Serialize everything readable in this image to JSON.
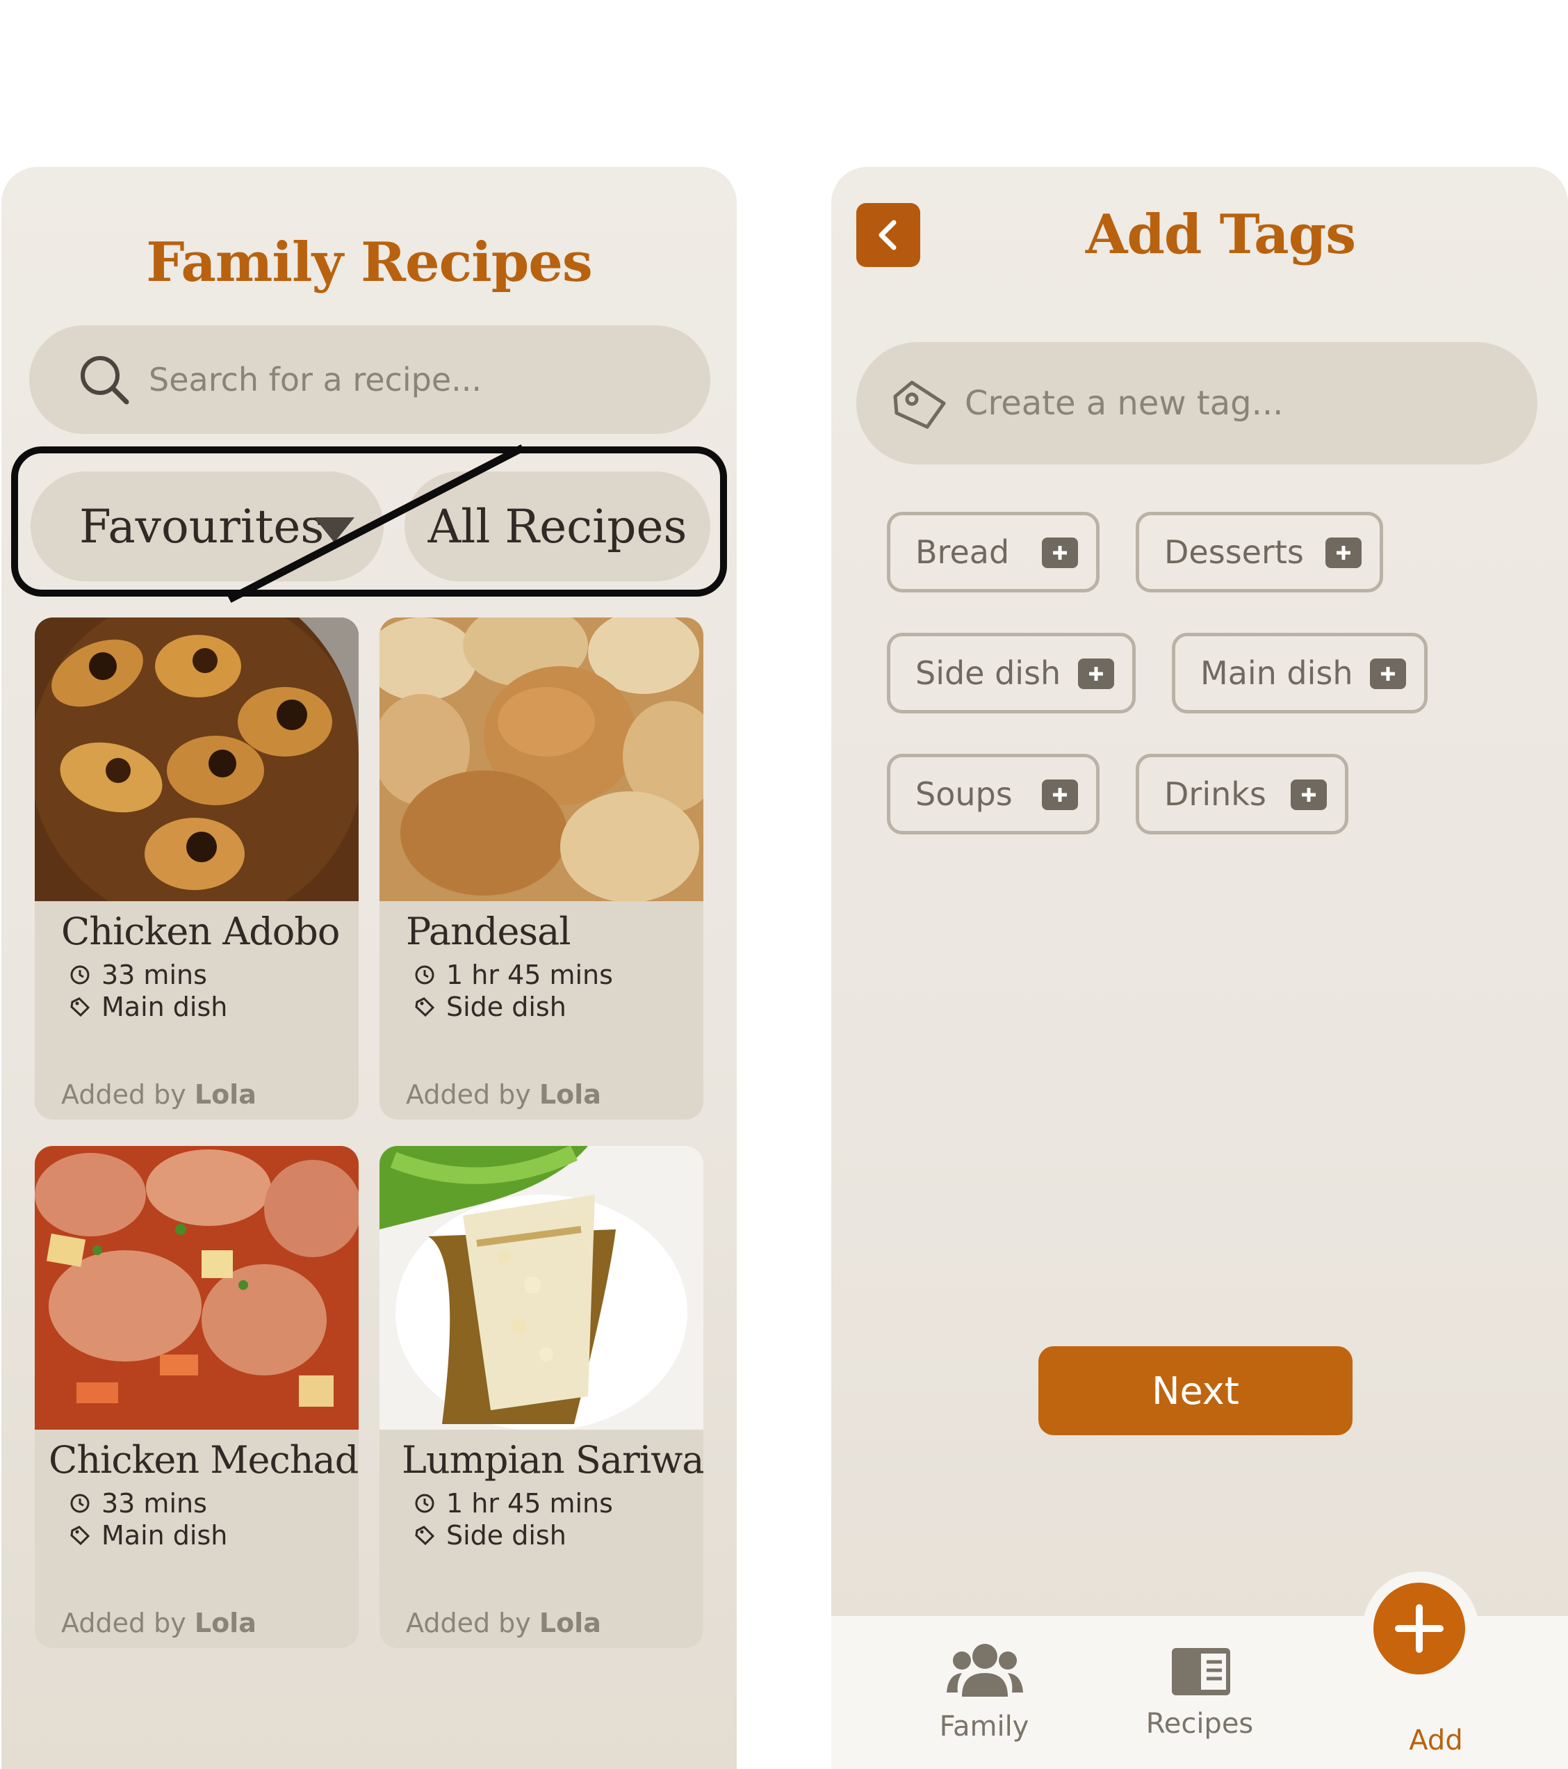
{
  "left_screen": {
    "title": "Family Recipes",
    "search": {
      "placeholder": "Search for a recipe..."
    },
    "filters": {
      "favourites_label": "Favourites",
      "all_label": "All Recipes"
    },
    "recipes": [
      {
        "name": "Chicken Adobo",
        "time": "33 mins",
        "category": "Main dish",
        "added_prefix": "Added by",
        "added_by": "Lola"
      },
      {
        "name": "Pandesal",
        "time": "1 hr 45 mins",
        "category": "Side dish",
        "added_prefix": "Added by",
        "added_by": "Lola"
      },
      {
        "name": "Chicken Mechado",
        "time": "33 mins",
        "category": "Main dish",
        "added_prefix": "Added by",
        "added_by": "Lola"
      },
      {
        "name": "Lumpian Sariwa",
        "time": "1 hr 45 mins",
        "category": "Side dish",
        "added_prefix": "Added by",
        "added_by": "Lola"
      }
    ]
  },
  "right_screen": {
    "title": "Add Tags",
    "tag_input": {
      "placeholder": "Create a new tag..."
    },
    "tags": [
      "Bread",
      "Desserts",
      "Side dish",
      "Main dish",
      "Soups",
      "Drinks"
    ],
    "next_label": "Next",
    "nav": {
      "family": "Family",
      "recipes": "Recipes",
      "add": "Add"
    }
  },
  "colors": {
    "accent": "#b8620f",
    "button": "#bf650f",
    "panel_bg": "#efebe5",
    "field_bg": "#ddd6ca",
    "text_dark": "#2f2a25",
    "text_muted": "#8a8478"
  },
  "icons": [
    "search-icon",
    "dropdown-caret-icon",
    "clock-icon",
    "tag-icon",
    "chevron-left-icon",
    "plus-icon",
    "family-icon",
    "recipes-icon",
    "add-icon"
  ]
}
